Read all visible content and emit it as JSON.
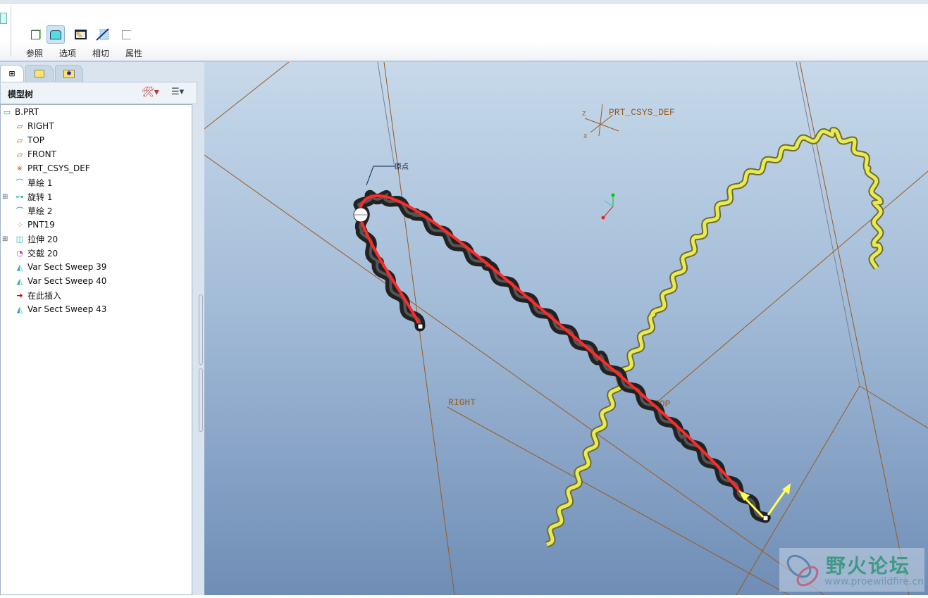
{
  "toolbar": {
    "buttons": [
      {
        "label": "参照",
        "icon": "reference-icon"
      },
      {
        "label": "选项",
        "icon": "options-icon"
      },
      {
        "label": "相切",
        "icon": "tangent-icon"
      },
      {
        "label": "属性",
        "icon": "properties-icon"
      }
    ]
  },
  "panel": {
    "title": "模型树",
    "tabs": [
      "model-tree-tab",
      "folder-browser-tab",
      "favorites-tab"
    ]
  },
  "tree": [
    {
      "label": "B.PRT",
      "icon": "part-icon"
    },
    {
      "label": "RIGHT",
      "icon": "datum-plane-icon"
    },
    {
      "label": "TOP",
      "icon": "datum-plane-icon"
    },
    {
      "label": "FRONT",
      "icon": "datum-plane-icon"
    },
    {
      "label": "PRT_CSYS_DEF",
      "icon": "csys-icon"
    },
    {
      "label": "草绘 1",
      "icon": "sketch-icon"
    },
    {
      "label": "旋转 1",
      "icon": "revolve-icon",
      "expand": true
    },
    {
      "label": "草绘 2",
      "icon": "sketch-icon"
    },
    {
      "label": "PNT19",
      "icon": "datum-point-icon"
    },
    {
      "label": "拉伸 20",
      "icon": "extrude-icon",
      "expand": true
    },
    {
      "label": "交截 20",
      "icon": "intersect-icon"
    },
    {
      "label": "Var Sect Sweep 39",
      "icon": "sweep-icon"
    },
    {
      "label": "Var Sect Sweep 40",
      "icon": "sweep-icon"
    },
    {
      "label": "在此插入",
      "icon": "insert-here-arrow-icon"
    },
    {
      "label": "Var Sect Sweep 43",
      "icon": "sweep-icon"
    }
  ],
  "viewport": {
    "csys_label": "PRT_CSYS_DEF",
    "csys_axis": "Z",
    "csys_axis_x": "X",
    "right_label": "RIGHT",
    "top_label": "TOP",
    "origin_label": "原点"
  },
  "watermark": {
    "name": "野火论坛",
    "url": "www.proewildfire.cn"
  },
  "colors": {
    "plane": "#9a5a1e",
    "trajectory": "#ff2a2a",
    "preview": "#e8e84a"
  }
}
